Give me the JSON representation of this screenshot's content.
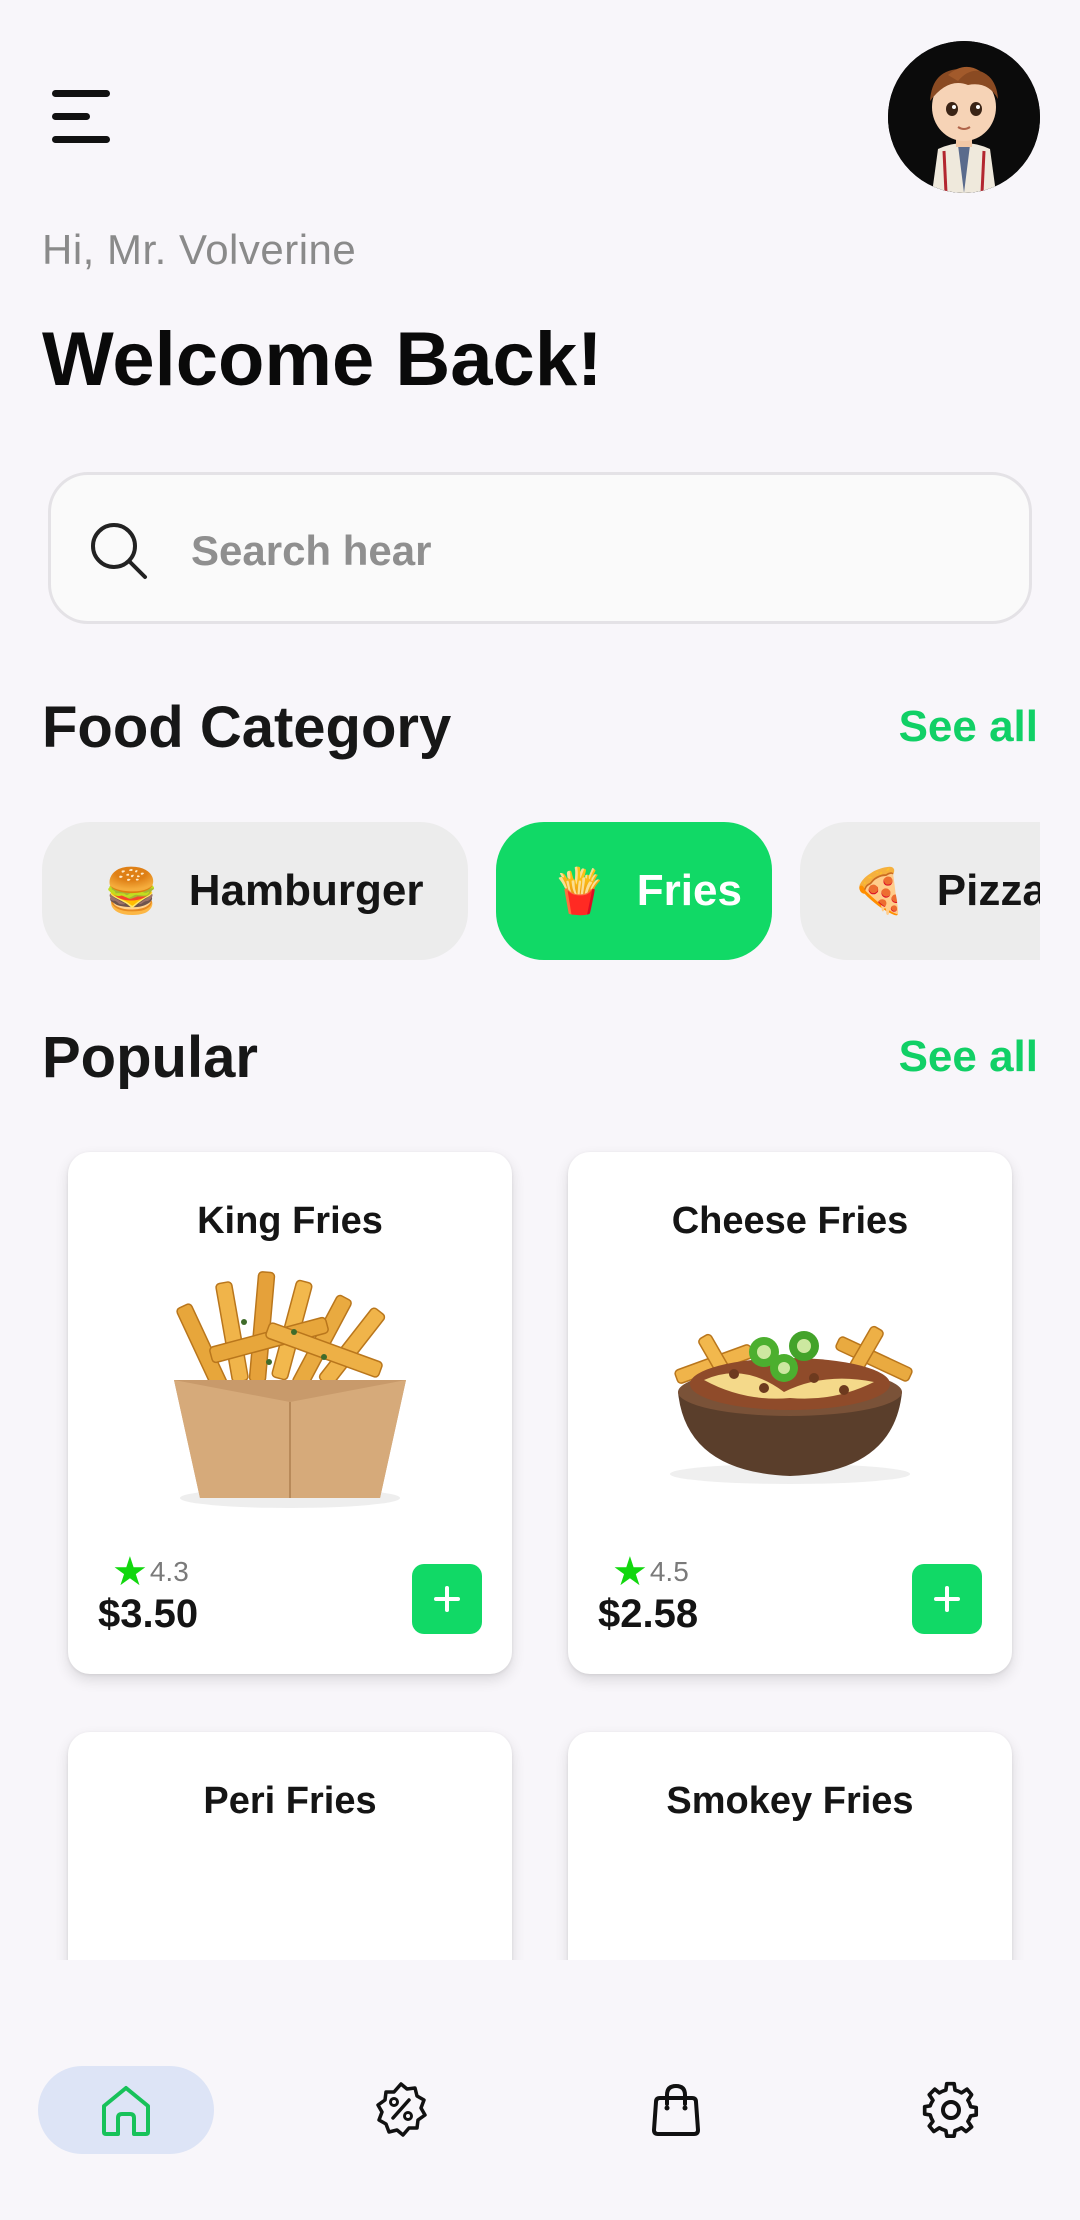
{
  "header": {
    "greeting": "Hi, Mr. Volverine",
    "title": "Welcome Back!"
  },
  "search": {
    "placeholder": "Search hear",
    "value": ""
  },
  "categories": {
    "title": "Food Category",
    "see_all": "See all",
    "items": [
      {
        "label": "Hamburger",
        "emoji": "🍔",
        "active": false
      },
      {
        "label": "Fries",
        "emoji": "🍟",
        "active": true
      },
      {
        "label": "Pizza",
        "emoji": "🍕",
        "active": false
      }
    ]
  },
  "popular": {
    "title": "Popular",
    "see_all": "See all",
    "items": [
      {
        "name": "King Fries",
        "rating": "4.3",
        "price": "$3.50"
      },
      {
        "name": "Cheese Fries",
        "rating": "4.5",
        "price": "$2.58"
      },
      {
        "name": "Peri Fries"
      },
      {
        "name": "Smokey Fries"
      }
    ]
  },
  "nav": {
    "items": [
      {
        "icon": "home-icon",
        "active": true
      },
      {
        "icon": "discount-icon",
        "active": false
      },
      {
        "icon": "shopping-bag-icon",
        "active": false
      },
      {
        "icon": "settings-gear-icon",
        "active": false
      }
    ]
  },
  "colors": {
    "accent": "#11D966",
    "star": "#12D70E",
    "nav_active_bg": "#DDE4F6"
  }
}
